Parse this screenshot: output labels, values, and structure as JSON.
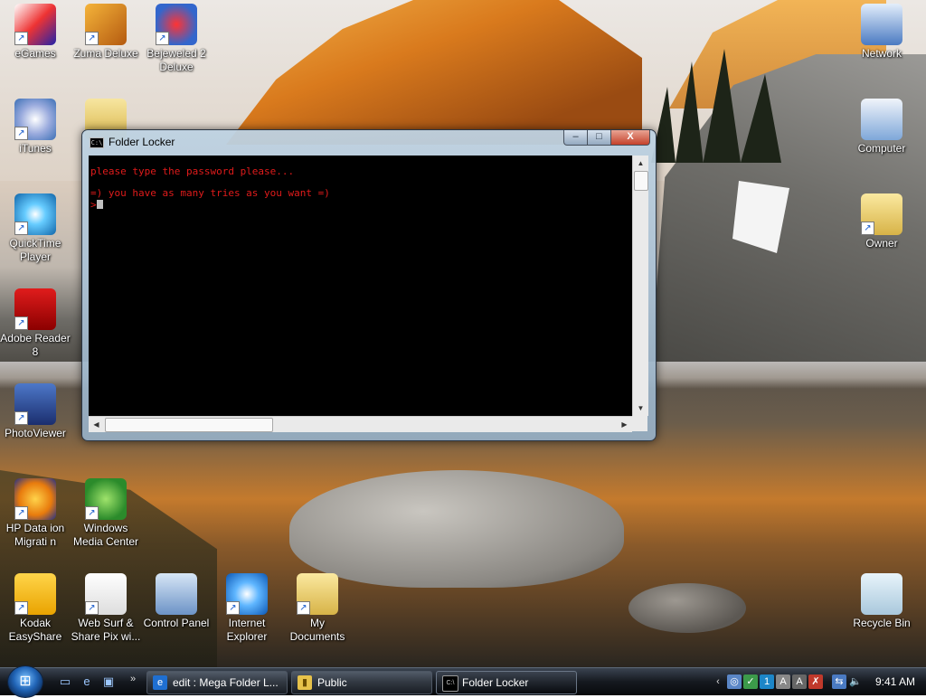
{
  "desktop_icons": {
    "egames": "eGames",
    "zuma": "Zuma Deluxe",
    "bejeweled": "Bejeweled 2 Deluxe",
    "itunes": "iTunes",
    "quicktime": "QuickTime Player",
    "adobe": "Adobe Reader 8",
    "photoviewer": "PhotoViewer",
    "hp": "HP Data ion Migrati n",
    "wmc": "Windows Media Center",
    "kodak": "Kodak EasyShare",
    "websurf": "Web Surf & Share Pix wi...",
    "control_panel": "Control Panel",
    "ie": "Internet Explorer",
    "my_documents": "My Documents",
    "network": "Network",
    "computer": "Computer",
    "owner": "Owner",
    "recycle_bin": "Recycle Bin"
  },
  "window": {
    "title": "Folder Locker",
    "icon_label": "C:\\",
    "minimize": "–",
    "maximize": "□",
    "close": "X",
    "console": {
      "line1": "please type the password please...",
      "line2": "=) you have as many tries as you want =)",
      "prompt": ">"
    }
  },
  "taskbar": {
    "start_glyph": "⊞",
    "tasks": [
      {
        "label": "edit : Mega Folder L...",
        "icon": "e"
      },
      {
        "label": "Public",
        "icon": "▮"
      },
      {
        "label": "Folder Locker",
        "icon": "C:\\"
      }
    ],
    "tray_chevron": "‹",
    "clock": "9:41 AM"
  }
}
